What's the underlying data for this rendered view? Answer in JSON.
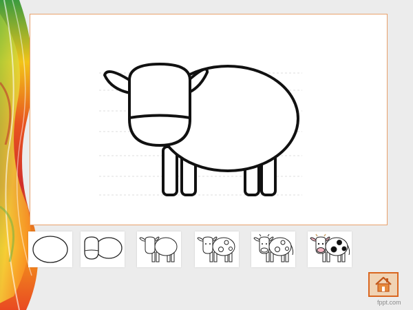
{
  "footer": {
    "brand": "fppt.com"
  },
  "home": {
    "icon": "home-icon"
  },
  "steps": [
    {
      "name": "step-1-oval-body"
    },
    {
      "name": "step-2-head-and-body"
    },
    {
      "name": "step-3-ears-legs"
    },
    {
      "name": "step-4-spots"
    },
    {
      "name": "step-5-details"
    },
    {
      "name": "step-6-colored-cow"
    }
  ],
  "colors": {
    "frame_border": "#e8a06a",
    "home_border": "#d9661f",
    "home_fill": "#f0d3b4",
    "background": "#ececec"
  }
}
